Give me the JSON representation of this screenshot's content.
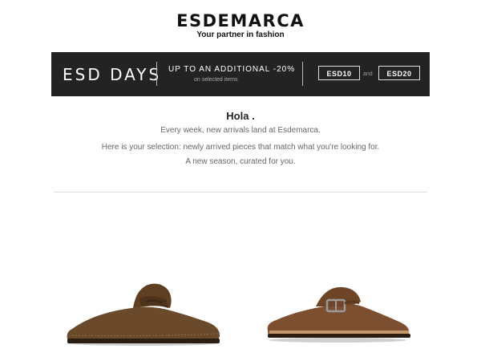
{
  "header": {
    "brand": "ESDEMARCA",
    "tagline": "Your partner in fashion"
  },
  "banner": {
    "title": "ESD DAYS",
    "offer": "UP TO AN ADDITIONAL -20%",
    "offer_sub": "on selected items",
    "code_1": "ESD10",
    "connector": "and",
    "code_2": "ESD20"
  },
  "intro": {
    "greeting": "Hola .",
    "line_1": "Every week, new arrivals land at Esdemarca.",
    "line_2": "Here is your selection: newly arrived pieces that match what you're looking for.",
    "line_3": "A new season, curated for you."
  },
  "products": [
    {
      "type": "brown suede penny loafer mule",
      "color": "#6b4a2b"
    },
    {
      "type": "brown suede buckle clog",
      "color": "#7b4f2f"
    }
  ]
}
